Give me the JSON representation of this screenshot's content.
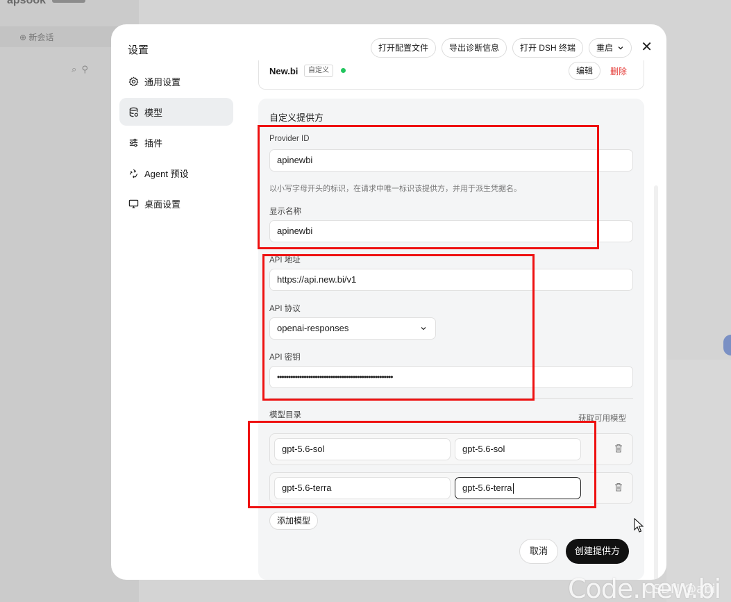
{
  "background": {
    "new_chat": "新会话"
  },
  "modal": {
    "title": "设置",
    "actions": {
      "open_config": "打开配置文件",
      "export_diag": "导出诊断信息",
      "open_terminal": "打开 DSH 终端",
      "restart": "重启"
    }
  },
  "nav": {
    "items": [
      {
        "label": "通用设置",
        "icon": "gear-icon"
      },
      {
        "label": "模型",
        "icon": "database-icon"
      },
      {
        "label": "插件",
        "icon": "sliders-icon"
      },
      {
        "label": "Agent 预设",
        "icon": "recycle-icon"
      },
      {
        "label": "桌面设置",
        "icon": "monitor-icon"
      }
    ],
    "active": "模型"
  },
  "provider": {
    "name": "New.bi",
    "tag": "自定义",
    "status_color": "#22c55e",
    "edit": "编辑",
    "delete": "删除"
  },
  "form": {
    "title": "自定义提供方",
    "provider_id_label": "Provider ID",
    "provider_id": "apinewbi",
    "provider_id_hint": "以小写字母开头的标识，在请求中唯一标识该提供方，并用于派生凭据名。",
    "display_name_label": "显示名称",
    "display_name": "apinewbi",
    "api_url_label": "API 地址",
    "api_url": "https://api.new.bi/v1",
    "api_protocol_label": "API 协议",
    "api_protocol": "openai-responses",
    "api_key_label": "API 密钥",
    "api_key": "••••••••••••••••••••••••••••••••••••••••••••••••••••",
    "model_catalog_label": "模型目录",
    "fetch_models": "获取可用模型",
    "models": [
      {
        "id": "gpt-5.6-sol",
        "name": "gpt-5.6-sol"
      },
      {
        "id": "gpt-5.6-terra",
        "name": "gpt-5.6-terra"
      }
    ],
    "add_model": "添加模型",
    "cancel": "取消",
    "create": "创建提供方"
  },
  "watermark": "Code.new.bi",
  "watermark_sub": "CSDN @abi"
}
